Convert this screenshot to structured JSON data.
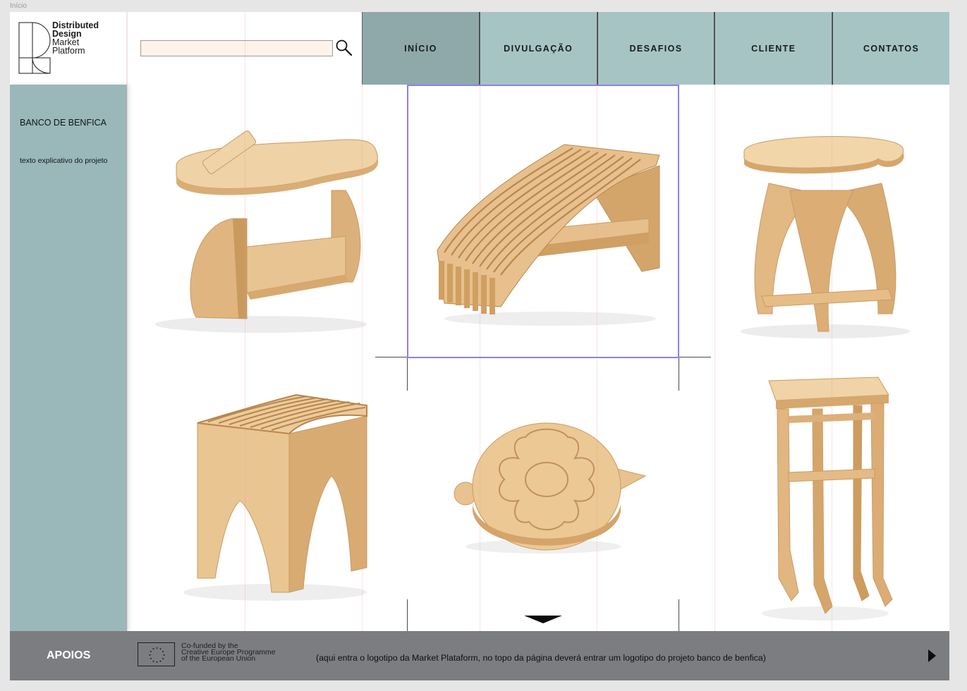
{
  "frame": {
    "label": "Início"
  },
  "logo": {
    "line1": "Distributed",
    "line2": "Design",
    "line3": "Market",
    "line4": "Platform"
  },
  "search": {
    "placeholder": "",
    "value": "",
    "icon": "search-icon"
  },
  "nav": {
    "items": [
      {
        "label": "INÍCIO",
        "active": true
      },
      {
        "label": "DIVULGAÇÃO",
        "active": false
      },
      {
        "label": "DESAFIOS",
        "active": false
      },
      {
        "label": "CLIENTE",
        "active": false
      },
      {
        "label": "CONTATOS",
        "active": false
      }
    ]
  },
  "sidebar": {
    "title": "BANCO DE BENFICA",
    "text": "texto explicativo do projeto"
  },
  "gallery": {
    "items": [
      {
        "name": "stool-with-magazine-rack"
      },
      {
        "name": "slatted-wave-bench"
      },
      {
        "name": "round-arched-stool"
      },
      {
        "name": "slatted-arch-stool"
      },
      {
        "name": "round-flat-pack-seat"
      },
      {
        "name": "tall-bar-stool"
      }
    ]
  },
  "footer": {
    "title": "APOIOS",
    "eu_line1": "Co-funded by the",
    "eu_line2": "Creative Europe Programme",
    "eu_line3": "of the European Union",
    "note": "(aqui entra o logotipo da Market Plataform, no topo da página deverá entrar um logotipo do projeto banco de benfica)"
  },
  "colors": {
    "nav_bg": "#a7c4c4",
    "nav_active": "#8fa9aa",
    "sidebar_bg": "#9ab8ba",
    "footer_bg": "#7b7d81",
    "search_bg": "#fdf3ea",
    "selection": "#8b80f0",
    "wood": "#e3bb86"
  }
}
